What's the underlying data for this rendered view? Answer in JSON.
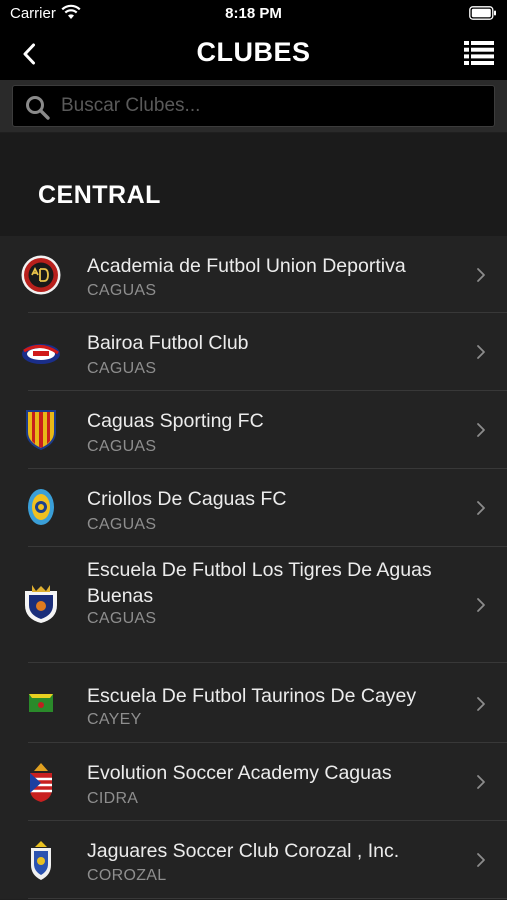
{
  "status_bar": {
    "carrier": "Carrier",
    "time": "8:18 PM"
  },
  "nav": {
    "title": "CLUBES"
  },
  "search": {
    "placeholder": "Buscar Clubes..."
  },
  "section": {
    "title": "CENTRAL"
  },
  "clubs": [
    {
      "name": "Academia de Futbol Union Deportiva",
      "city": "CAGUAS",
      "logo": "union-deportiva-logo-icon"
    },
    {
      "name": "Bairoa Futbol Club",
      "city": "CAGUAS",
      "logo": "bairoa-logo-icon"
    },
    {
      "name": "Caguas Sporting FC",
      "city": "CAGUAS",
      "logo": "caguas-sporting-shield-icon"
    },
    {
      "name": "Criollos De Caguas FC",
      "city": "CAGUAS",
      "logo": "criollos-logo-icon"
    },
    {
      "name": "Escuela De Futbol Los Tigres De Aguas Buenas",
      "city": "CAGUAS",
      "logo": "los-tigres-logo-icon"
    },
    {
      "name": "Escuela De Futbol Taurinos De Cayey",
      "city": "CAYEY",
      "logo": "taurinos-logo-icon"
    },
    {
      "name": "Evolution Soccer Academy Caguas",
      "city": "CIDRA",
      "logo": "evolution-logo-icon"
    },
    {
      "name": "Jaguares Soccer Club Corozal , Inc.",
      "city": "COROZAL",
      "logo": "jaguares-logo-icon"
    }
  ]
}
